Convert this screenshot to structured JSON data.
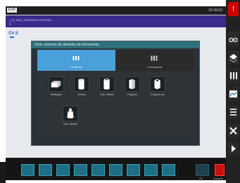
{
  "header": {
    "mode": "EXP",
    "time": "02:49:53"
  },
  "program": {
    "path": "/_N/_WKS_DIR/DEMO.WPD/GAL...",
    "line2": "1",
    "label": "Ch S"
  },
  "dialog": {
    "title": "Criar contorno de desenho de ferramenta",
    "tabs": [
      {
        "label": "Pc.Bruta",
        "icon": "bar-stock-icon"
      },
      {
        "label": "Ferramenta",
        "icon": "tool-icon"
      }
    ],
    "tiles": [
      {
        "label": "Retângulo",
        "icon": "rectangle-block-icon"
      },
      {
        "label": "Cilindro",
        "icon": "cylinder-icon"
      },
      {
        "label": "Tubo Cilindro",
        "icon": "tube-cylinder-icon"
      },
      {
        "label": "Poligono",
        "icon": "polygon-prism-icon"
      },
      {
        "label": "Polígono oco",
        "icon": "hollow-polygon-icon"
      },
      {
        "label": "Com Cilindro",
        "icon": "cone-cylinder-icon"
      }
    ]
  },
  "bottom": {
    "ok_label": "OK",
    "cancel_label": "Cancelar"
  },
  "sidebar": {
    "buttons": [
      "alarm-icon",
      "oo-icon",
      "layers-icon",
      "columns-icon",
      "chart-icon",
      "list-icon",
      "close-icon",
      "next-icon"
    ]
  },
  "colors": {
    "accent": "#4aa0d8",
    "title_bar": "#2d6f7a",
    "program_strip": "#3a2a8a",
    "cancel": "#cc1010"
  }
}
